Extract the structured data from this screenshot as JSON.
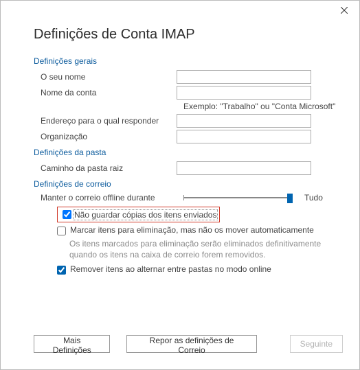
{
  "window": {
    "title": "Definições de Conta IMAP"
  },
  "sections": {
    "general": {
      "header": "Definições gerais",
      "yourName": {
        "label": "O seu nome",
        "value": ""
      },
      "accountName": {
        "label": "Nome da conta",
        "value": ""
      },
      "example": "Exemplo: \"Trabalho\" ou \"Conta Microsoft\"",
      "replyTo": {
        "label": "Endereço para o qual responder",
        "value": ""
      },
      "organization": {
        "label": "Organização",
        "value": ""
      }
    },
    "folder": {
      "header": "Definições da pasta",
      "rootPath": {
        "label": "Caminho da pasta raiz",
        "value": ""
      }
    },
    "mail": {
      "header": "Definições de correio",
      "keepOffline": {
        "label": "Manter o correio offline durante",
        "valueText": "Tudo"
      },
      "dontSaveSent": {
        "label": "Não guardar cópias dos itens enviados",
        "checked": true
      },
      "markForDeletion": {
        "label": "Marcar itens para eliminação, mas não os mover automaticamente",
        "checked": false,
        "helper": "Os itens marcados para eliminação serão eliminados definitivamente quando os itens na caixa de correio forem removidos."
      },
      "removeOnSwitch": {
        "label": "Remover itens ao alternar entre pastas no modo online",
        "checked": true
      }
    }
  },
  "buttons": {
    "more": "Mais Definições",
    "reset": "Repor as definições de Correio",
    "next": "Seguinte"
  }
}
